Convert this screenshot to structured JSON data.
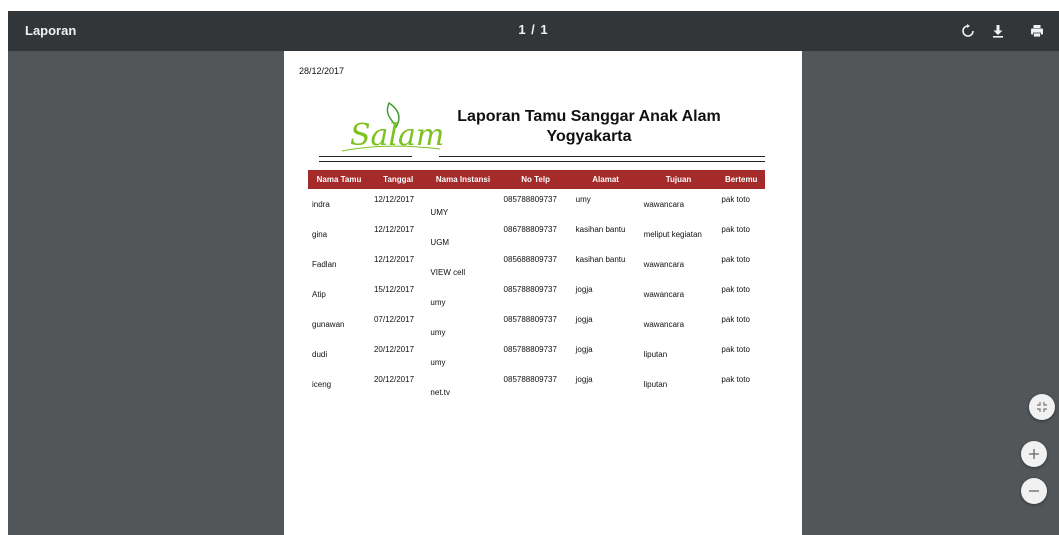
{
  "toolbar": {
    "title": "Laporan",
    "page_indicator": "1 / 1"
  },
  "icons": {
    "rotate": "rotate-icon",
    "download": "download-icon",
    "print": "print-icon",
    "fit": "fit-to-page-icon",
    "zoom_in": "zoom-in-icon",
    "zoom_out": "zoom-out-icon"
  },
  "colors": {
    "toolbar_bg": "#323639",
    "viewer_bg": "#525659",
    "table_header_bg": "#a52a2a",
    "logo_green": "#7cc21e"
  },
  "report": {
    "date": "28/12/2017",
    "title": "Laporan Tamu Sanggar Anak Alam Yogyakarta",
    "logo_text": "Salam",
    "columns": [
      "Nama Tamu",
      "Tanggal",
      "Nama Instansi",
      "No Telp",
      "Alamat",
      "Tujuan",
      "Bertemu"
    ],
    "rows": [
      [
        "indra",
        "12/12/2017",
        "UMY",
        "085788809737",
        "umy",
        "wawancara",
        "pak toto"
      ],
      [
        "gina",
        "12/12/2017",
        "UGM",
        "086788809737",
        "kasihan bantu",
        "meliput kegiatan",
        "pak toto"
      ],
      [
        "Fadlan",
        "12/12/2017",
        "VIEW cell",
        "085688809737",
        "kasihan bantu",
        "wawancara",
        "pak toto"
      ],
      [
        "Atip",
        "15/12/2017",
        "umy",
        "085788809737",
        "jogja",
        "wawancara",
        "pak toto"
      ],
      [
        "gunawan",
        "07/12/2017",
        "umy",
        "085788809737",
        "jogja",
        "wawancara",
        "pak toto"
      ],
      [
        "dudi",
        "20/12/2017",
        "umy",
        "085788809737",
        "jogja",
        "liputan",
        "pak toto"
      ],
      [
        "iceng",
        "20/12/2017",
        "net.tv",
        "085788809737",
        "jogja",
        "liputan",
        "pak toto"
      ]
    ]
  }
}
